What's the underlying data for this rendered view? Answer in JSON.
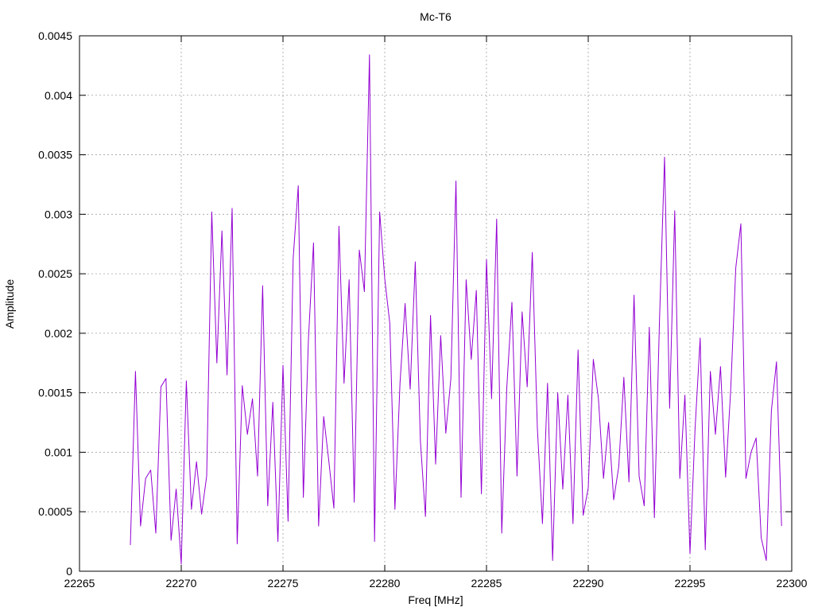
{
  "chart_data": {
    "type": "line",
    "title": "Mc-T6",
    "xlabel": "Freq [MHz]",
    "ylabel": "Amplitude",
    "xlim": [
      22265,
      22300
    ],
    "ylim": [
      0,
      0.0045
    ],
    "xticks": [
      "22265",
      "22270",
      "22275",
      "22280",
      "22285",
      "22290",
      "22295",
      "22300"
    ],
    "yticks": [
      "0",
      "0.0005",
      "0.001",
      "0.0015",
      "0.002",
      "0.0025",
      "0.003",
      "0.0035",
      "0.004",
      "0.0045"
    ],
    "grid": true,
    "series_color": "#9400d3",
    "x": [
      22267.5,
      22267.75,
      22268.0,
      22268.25,
      22268.5,
      22268.75,
      22269.0,
      22269.25,
      22269.5,
      22269.75,
      22270.0,
      22270.25,
      22270.5,
      22270.75,
      22271.0,
      22271.25,
      22271.5,
      22271.75,
      22272.0,
      22272.25,
      22272.5,
      22272.75,
      22273.0,
      22273.25,
      22273.5,
      22273.75,
      22274.0,
      22274.25,
      22274.5,
      22274.75,
      22275.0,
      22275.25,
      22275.5,
      22275.75,
      22276.0,
      22276.25,
      22276.5,
      22276.75,
      22277.0,
      22277.25,
      22277.5,
      22277.75,
      22278.0,
      22278.25,
      22278.5,
      22278.75,
      22279.0,
      22279.25,
      22279.5,
      22279.75,
      22280.0,
      22280.25,
      22280.5,
      22280.75,
      22281.0,
      22281.25,
      22281.5,
      22281.75,
      22282.0,
      22282.25,
      22282.5,
      22282.75,
      22283.0,
      22283.25,
      22283.5,
      22283.75,
      22284.0,
      22284.25,
      22284.5,
      22284.75,
      22285.0,
      22285.25,
      22285.5,
      22285.75,
      22286.0,
      22286.25,
      22286.5,
      22286.75,
      22287.0,
      22287.25,
      22287.5,
      22287.75,
      22288.0,
      22288.25,
      22288.5,
      22288.75,
      22289.0,
      22289.25,
      22289.5,
      22289.75,
      22290.0,
      22290.25,
      22290.5,
      22290.75,
      22291.0,
      22291.25,
      22291.5,
      22291.75,
      22292.0,
      22292.25,
      22292.5,
      22292.75,
      22293.0,
      22293.25,
      22293.5,
      22293.75,
      22294.0,
      22294.25,
      22294.5,
      22294.75,
      22295.0,
      22295.25,
      22295.5,
      22295.75,
      22296.0,
      22296.25,
      22296.5,
      22296.75,
      22297.0,
      22297.25,
      22297.5,
      22297.75,
      22298.0,
      22298.25,
      22298.5,
      22298.75,
      22299.0,
      22299.25,
      22299.5
    ],
    "y": [
      0.00022,
      0.00168,
      0.00038,
      0.00078,
      0.00085,
      0.00032,
      0.00155,
      0.00162,
      0.00026,
      0.00069,
      6e-05,
      0.0016,
      0.00052,
      0.00092,
      0.00048,
      0.0008,
      0.00302,
      0.00175,
      0.00286,
      0.00165,
      0.00305,
      0.00023,
      0.00156,
      0.00115,
      0.00145,
      0.0008,
      0.0024,
      0.00055,
      0.00142,
      0.00025,
      0.00173,
      0.00042,
      0.00263,
      0.00324,
      0.00062,
      0.00195,
      0.00276,
      0.00038,
      0.0013,
      0.00093,
      0.00053,
      0.0029,
      0.00158,
      0.00245,
      0.00058,
      0.0027,
      0.00235,
      0.00434,
      0.00025,
      0.00302,
      0.00246,
      0.00208,
      0.00052,
      0.00158,
      0.00225,
      0.00153,
      0.0026,
      0.0011,
      0.00046,
      0.00215,
      0.0009,
      0.00198,
      0.00116,
      0.00162,
      0.00328,
      0.00062,
      0.00245,
      0.00178,
      0.00236,
      0.00065,
      0.00262,
      0.00145,
      0.00296,
      0.00032,
      0.00155,
      0.00226,
      0.0008,
      0.00218,
      0.00155,
      0.00268,
      0.0012,
      0.0004,
      0.00158,
      9e-05,
      0.0015,
      0.00069,
      0.00148,
      0.0004,
      0.00186,
      0.00047,
      0.0007,
      0.00178,
      0.00145,
      0.00078,
      0.00125,
      0.0006,
      0.00088,
      0.00163,
      0.00075,
      0.00232,
      0.0008,
      0.00055,
      0.00205,
      0.00045,
      0.0021,
      0.00348,
      0.00137,
      0.00303,
      0.00078,
      0.00148,
      0.00015,
      0.0012,
      0.00196,
      0.00018,
      0.00168,
      0.00115,
      0.00172,
      0.00079,
      0.00152,
      0.00255,
      0.00292,
      0.00078,
      0.001,
      0.00112,
      0.00028,
      9e-05,
      0.00135,
      0.00176,
      0.00038
    ]
  }
}
